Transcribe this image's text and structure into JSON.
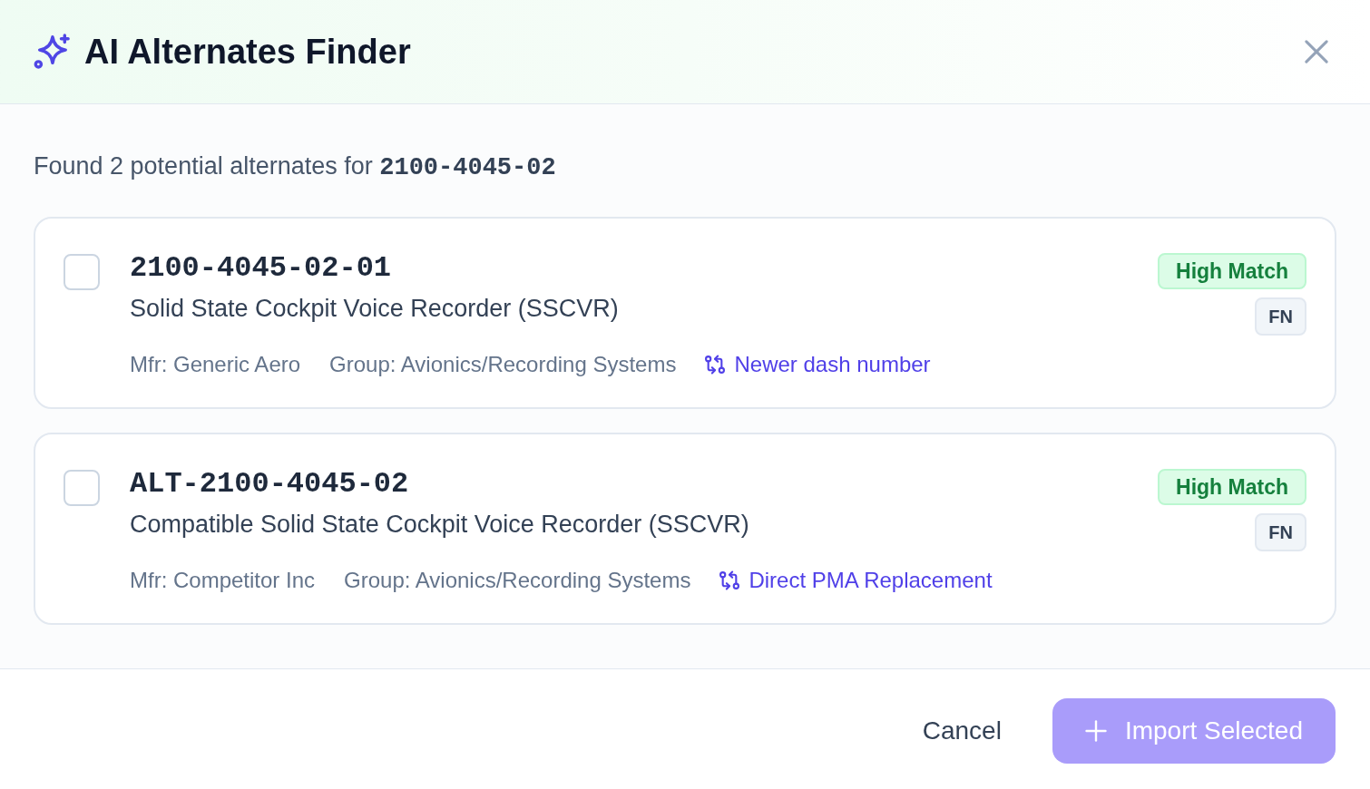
{
  "dialog": {
    "title": "AI Alternates Finder"
  },
  "summary": "Found 2 potential alternates for **2100-4045-02**",
  "alternates": [
    {
      "checked": false,
      "part_number": "2100-4045-02-01",
      "description": "Solid State Cockpit Voice Recorder (SSCVR)",
      "manufacturer": "Mfr: Generic Aero",
      "group": "Group: Avionics/Recording Systems",
      "reason": "Newer dash number",
      "match": {
        "label": "High Match",
        "kind": "high"
      },
      "tag": "FN"
    },
    {
      "checked": false,
      "part_number": "ALT-2100-4045-02",
      "description": "Compatible Solid State Cockpit Voice Recorder (SSCVR)",
      "manufacturer": "Mfr: Competitor Inc",
      "group": "Group: Avionics/Recording Systems",
      "reason": "Direct PMA Replacement",
      "match": {
        "label": "High Match",
        "kind": "high"
      },
      "tag": "FN"
    }
  ],
  "footer": {
    "cancel": "Cancel",
    "import": {
      "label": "Import Selected",
      "disabled": true
    }
  }
}
